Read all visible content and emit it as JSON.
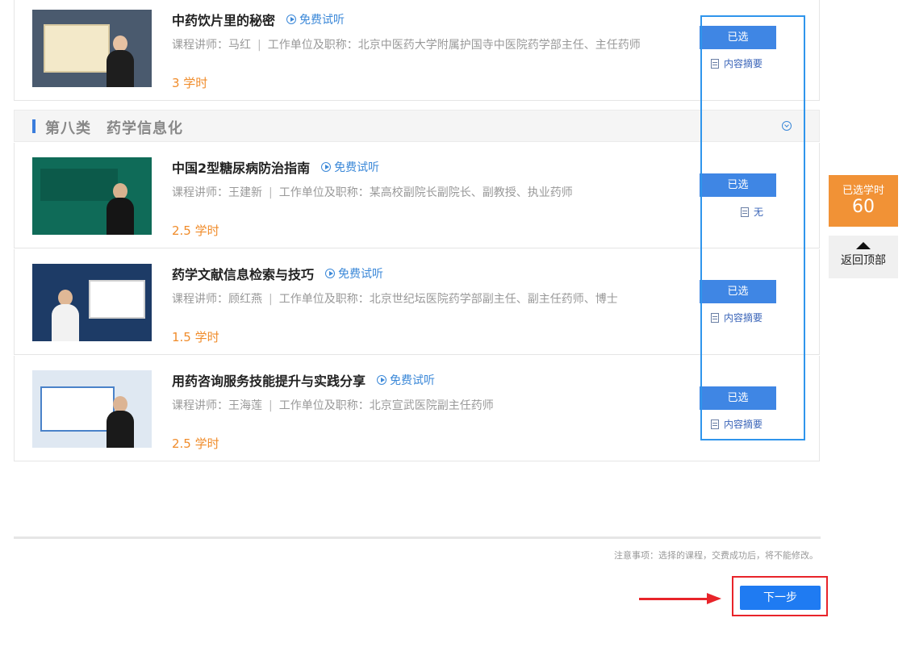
{
  "courses": [
    {
      "title": "中药饮片里的秘密",
      "trial": "免费试听",
      "lecturer": "课程讲师：马红",
      "sep": "|",
      "org": "工作单位及职称：北京中医药大学附属护国寺中医院药学部主任、主任药师",
      "hours": "3 学时",
      "select": "已选",
      "summary": "内容摘要",
      "thumb_colors": [
        "#4a5a6e",
        "#f3e9c9"
      ]
    },
    {
      "title": "中国2型糖尿病防治指南",
      "trial": "免费试听",
      "lecturer": "课程讲师：王建新",
      "sep": "|",
      "org": "工作单位及职称：某高校副院长副院长、副教授、执业药师",
      "hours": "2.5 学时",
      "select": "已选",
      "summary": "无",
      "thumb_colors": [
        "#0f6b58",
        "#156f5c"
      ]
    },
    {
      "title": "药学文献信息检索与技巧",
      "trial": "免费试听",
      "lecturer": "课程讲师：顾红燕",
      "sep": "|",
      "org": "工作单位及职称：北京世纪坛医院药学部副主任、副主任药师、博士",
      "hours": "1.5 学时",
      "select": "已选",
      "summary": "内容摘要",
      "thumb_colors": [
        "#1d3b66",
        "#ffffff"
      ]
    },
    {
      "title": "用药咨询服务技能提升与实践分享",
      "trial": "免费试听",
      "lecturer": "课程讲师：王海莲",
      "sep": "|",
      "org": "工作单位及职称：北京宣武医院副主任药师",
      "hours": "2.5 学时",
      "select": "已选",
      "summary": "内容摘要",
      "thumb_colors": [
        "#dfe8f2",
        "#ffffff"
      ]
    }
  ],
  "category": {
    "title": "第八类　药学信息化"
  },
  "sidebar": {
    "hours_label": "已选学时",
    "hours_value": "60",
    "back_top": "返回顶部"
  },
  "footer": {
    "notice": "注意事项：选择的课程，交费成功后，将不能修改。",
    "next": "下一步"
  },
  "colors": {
    "accent_blue": "#3f86e4",
    "orange": "#f08c2b",
    "highlight_red": "#e8242a"
  }
}
